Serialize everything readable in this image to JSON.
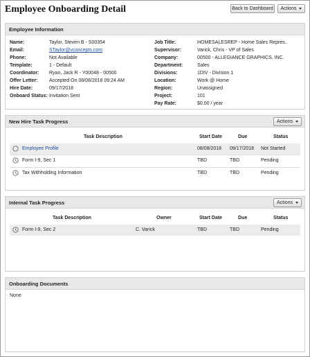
{
  "page": {
    "title": "Employee Onboarding Detail",
    "back_button": "Back to Dashboard",
    "actions_button": "Actions"
  },
  "employee_info": {
    "title": "Employee Information",
    "left": [
      {
        "label": "Name:",
        "value": "Taylor, Steven B - S00354"
      },
      {
        "label": "Email:",
        "value": "STaylor@vconcepts.com"
      },
      {
        "label": "Phone:",
        "value": "Not Available"
      },
      {
        "label": "Template:",
        "value": "1 - Default"
      },
      {
        "label": "Coordinator:",
        "value": "Ryan, Jack R - Y00048 - 00500"
      },
      {
        "label": "Offer Letter:",
        "value": "Accepted On 08/08/2018 09:24 AM"
      },
      {
        "label": "Hire Date:",
        "value": "09/17/2018"
      },
      {
        "label": "Onboard Status:",
        "value": "Invitation Sent"
      }
    ],
    "right": [
      {
        "label": "Job Title:",
        "value": "HOMESALESREP - Home Sales Repres.."
      },
      {
        "label": "Supervisor:",
        "value": "Varick, Chris - VP of Sales"
      },
      {
        "label": "Company:",
        "value": "00500 - ALLEGIANCE GRAPHICS, INC."
      },
      {
        "label": "Department:",
        "value": "Sales"
      },
      {
        "label": "Divisions:",
        "value": "1DIV - Division 1"
      },
      {
        "label": "Location:",
        "value": "Work @ Home"
      },
      {
        "label": "Region:",
        "value": "Unassigned"
      },
      {
        "label": "Project:",
        "value": "101"
      },
      {
        "label": "Pay Rate:",
        "value": "$0.00 / year"
      }
    ]
  },
  "new_hire_tasks": {
    "title": "New Hire Task Progress",
    "actions": "Actions",
    "columns": {
      "description": "Task Description",
      "start": "Start Date",
      "due": "Due",
      "status": "Status"
    },
    "rows": [
      {
        "icon": "circle-icon",
        "description": "Employee Profile",
        "start": "08/08/2018",
        "due": "09/17/2018",
        "status": "Not Started"
      },
      {
        "icon": "clock-icon",
        "description": "Form I-9, Sec 1",
        "start": "TBD",
        "due": "TBD",
        "status": "Pending"
      },
      {
        "icon": "clock-icon",
        "description": "Tax Withholding Information",
        "start": "TBD",
        "due": "TBD",
        "status": "Pending"
      }
    ]
  },
  "internal_tasks": {
    "title": "Internal Task Progress",
    "actions": "Actions",
    "columns": {
      "description": "Task Description",
      "owner": "Owner",
      "start": "Start Date",
      "due": "Due",
      "status": "Status"
    },
    "rows": [
      {
        "icon": "clock-icon",
        "description": "Form I-9, Sec 2",
        "owner": "C. Varick",
        "start": "TBD",
        "due": "TBD",
        "status": "Pending"
      }
    ]
  },
  "onboarding_documents": {
    "title": "Onboarding Documents",
    "empty_text": "None"
  }
}
